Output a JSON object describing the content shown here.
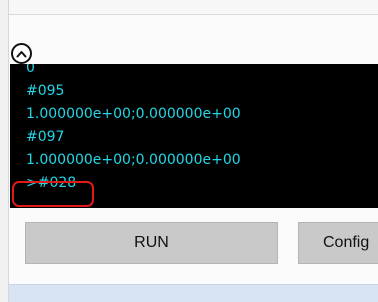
{
  "console": {
    "lines": [
      "0",
      "#095",
      "1.000000e+00;0.000000e+00",
      "#097",
      "1.000000e+00;0.000000e+00",
      ">#028"
    ],
    "text_color": "#22d6e6",
    "background": "#000000"
  },
  "controls": {
    "collapse_icon": "chevron-up-icon",
    "run_label": "RUN",
    "config_label": "Config"
  },
  "highlight": {
    "color": "#e01a1a"
  }
}
